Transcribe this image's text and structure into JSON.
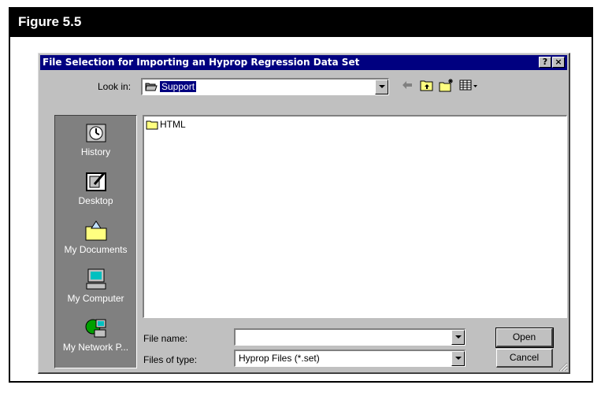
{
  "figure": {
    "title": "Figure 5.5"
  },
  "dialog": {
    "title": "File Selection for Importing an Hyprop Regression Data Set",
    "help_label": "?",
    "close_label": "×",
    "look_in": {
      "label": "Look in:",
      "value": "Support"
    },
    "places": [
      {
        "label": "History",
        "icon": "history-icon"
      },
      {
        "label": "Desktop",
        "icon": "desktop-icon"
      },
      {
        "label": "My Documents",
        "icon": "my-documents-icon"
      },
      {
        "label": "My Computer",
        "icon": "my-computer-icon"
      },
      {
        "label": "My Network P...",
        "icon": "my-network-places-icon"
      }
    ],
    "files": [
      {
        "name": "HTML",
        "icon": "folder-icon"
      }
    ],
    "file_name": {
      "label": "File name:",
      "value": ""
    },
    "file_type": {
      "label": "Files of type:",
      "value": "Hyprop Files (*.set)"
    },
    "buttons": {
      "open": "Open",
      "cancel": "Cancel"
    }
  }
}
